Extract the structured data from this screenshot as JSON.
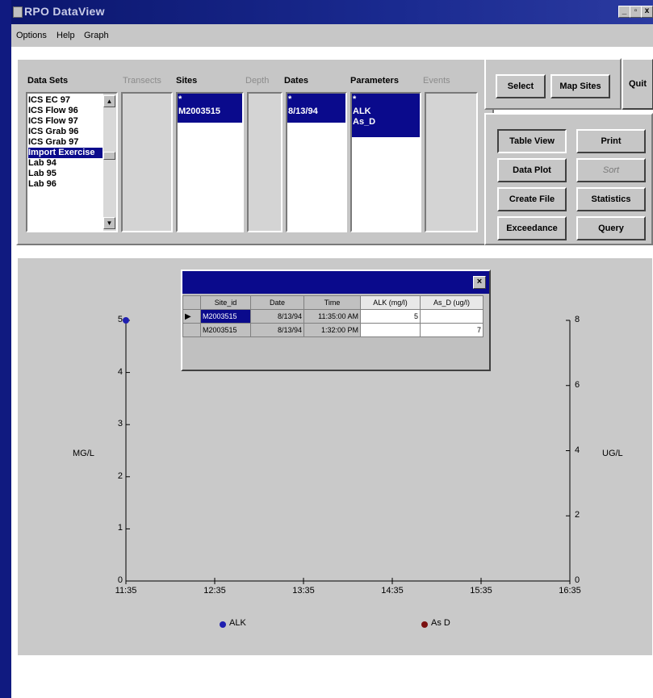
{
  "window": {
    "title": "RPO DataView",
    "controls": [
      "_",
      "▫",
      "x"
    ]
  },
  "menu": [
    "Options",
    "Help",
    "Graph"
  ],
  "selector": {
    "headers": {
      "data_sets": "Data Sets",
      "transects": "Transects",
      "sites": "Sites",
      "depth": "Depth",
      "dates": "Dates",
      "parameters": "Parameters",
      "events": "Events"
    },
    "data_sets": [
      "ICS EC 97",
      "ICS Flow 96",
      "ICS Flow 97",
      "ICS Grab 96",
      "ICS Grab 97",
      "Import Exercise",
      "Lab 94",
      "Lab 95",
      "Lab 96"
    ],
    "data_sets_selected": "Import Exercise",
    "sites": [
      "*",
      "M2003515"
    ],
    "dates": [
      "*",
      "8/13/94"
    ],
    "parameters": [
      "*",
      "ALK",
      "As_D"
    ]
  },
  "buttons": {
    "select": "Select",
    "map_sites": "Map Sites",
    "quit": "Quit",
    "table_view": "Table View",
    "print": "Print",
    "data_plot": "Data Plot",
    "sort": "Sort",
    "create_file": "Create File",
    "statistics": "Statistics",
    "exceedance": "Exceedance",
    "query": "Query"
  },
  "grid": {
    "columns": [
      "Site_id",
      "Date",
      "Time",
      "ALK (mg/l)",
      "As_D (ug/l)"
    ],
    "rows": [
      [
        "M2003515",
        "8/13/94",
        "11:35:00 AM",
        "5",
        ""
      ],
      [
        "M2003515",
        "8/13/94",
        "1:32:00 PM",
        "",
        "7"
      ]
    ]
  },
  "chart_data": {
    "type": "scatter",
    "x_ticks": [
      "11:35",
      "12:35",
      "13:35",
      "14:35",
      "15:35",
      "16:35"
    ],
    "y_left_label": "MG/L",
    "y_left_ticks": [
      "0",
      "1",
      "2",
      "3",
      "4",
      "5"
    ],
    "y_left_range": [
      0,
      5
    ],
    "y_right_label": "UG/L",
    "y_right_ticks": [
      "0",
      "2",
      "4",
      "6",
      "8"
    ],
    "y_right_range": [
      0,
      8
    ],
    "series": [
      {
        "name": "ALK",
        "color": "#1f1fb0",
        "axis": "left",
        "points": [
          {
            "x": "11:35",
            "y": 5
          }
        ]
      },
      {
        "name": "As D",
        "color": "#7a1010",
        "axis": "right",
        "points": []
      }
    ]
  },
  "colors": {
    "selection": "#0a0a8c",
    "face": "#c6c6c6",
    "desktop": "#101a80"
  }
}
